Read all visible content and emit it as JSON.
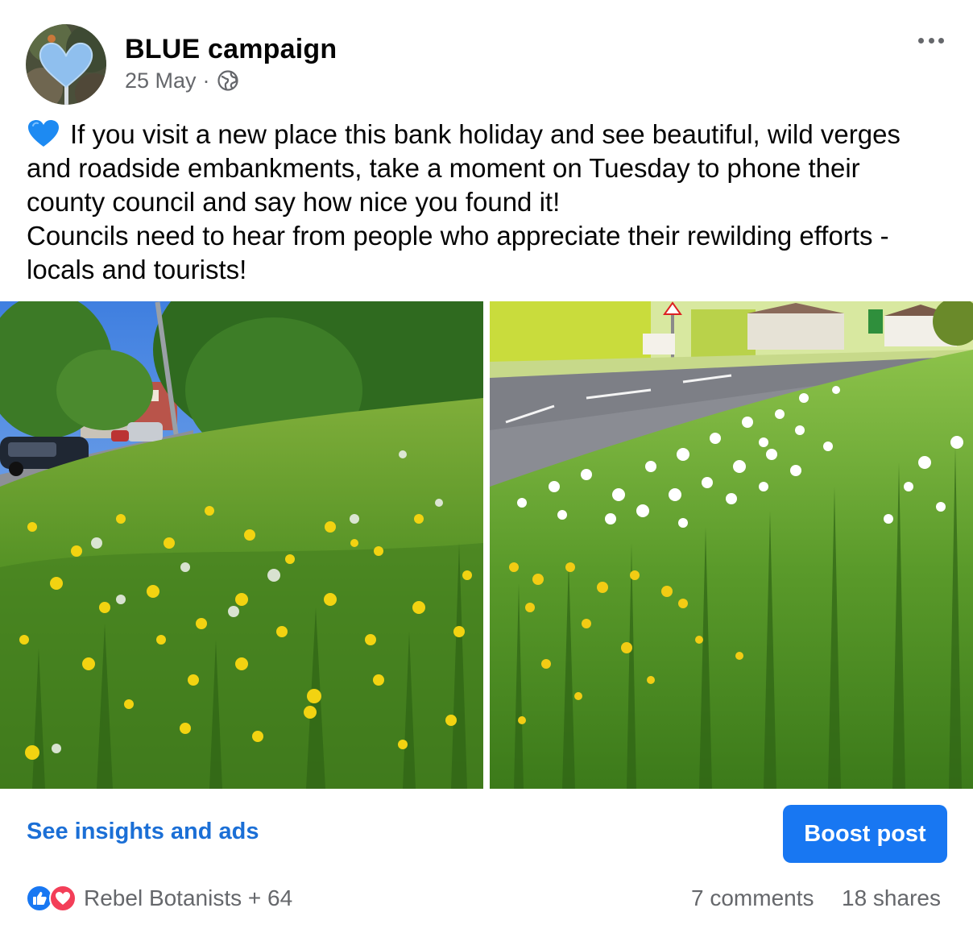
{
  "post": {
    "author": "BLUE campaign",
    "date": "25 May",
    "separator": "·",
    "privacy_icon": "globe-icon",
    "menu_icon": "more-options-icon",
    "emoji": "blue-heart-emoji",
    "text_lines": [
      "If you visit a new place this bank holiday and see beautiful, wild verges and roadside embankments, take a moment on Tuesday to phone their county council and say how nice you found it!",
      "Councils need to hear from people who appreciate their rewilding efforts - locals and tourists!"
    ],
    "photos": [
      {
        "description_icon": "roadside-dandelion-verge-photo"
      },
      {
        "description_icon": "roadside-daisy-verge-photo"
      }
    ]
  },
  "actions": {
    "insights_label": "See insights and ads",
    "boost_label": "Boost post"
  },
  "engagement": {
    "reactions_label": "Rebel Botanists + 64",
    "reaction_icons": [
      "like-icon",
      "love-icon"
    ],
    "comments_label": "7 comments",
    "shares_label": "18 shares"
  },
  "colors": {
    "brand_blue": "#1877f2",
    "link_blue": "#1b6fd6",
    "secondary_text": "#65676b",
    "love_red": "#f33e58"
  }
}
